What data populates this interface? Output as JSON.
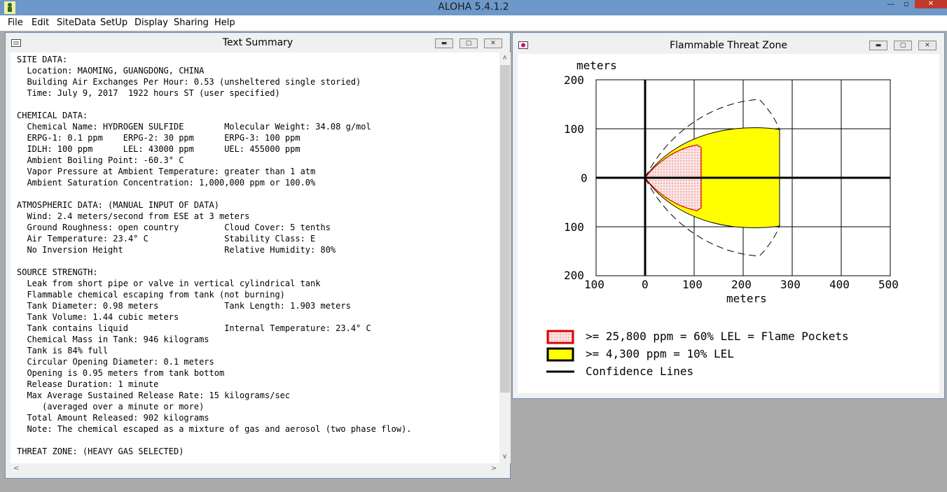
{
  "app": {
    "title": "ALOHA 5.4.1.2"
  },
  "menu": [
    "File",
    "Edit",
    "SiteData",
    "SetUp",
    "Display",
    "Sharing",
    "Help"
  ],
  "text_window": {
    "title": "Text Summary",
    "lines": [
      "SITE DATA:",
      "  Location: MAOMING, GUANGDONG, CHINA",
      "  Building Air Exchanges Per Hour: 0.53 (unsheltered single storied)",
      "  Time: July 9, 2017  1922 hours ST (user specified)",
      "",
      "CHEMICAL DATA:",
      "  Chemical Name: HYDROGEN SULFIDE        Molecular Weight: 34.08 g/mol",
      "  ERPG-1: 0.1 ppm    ERPG-2: 30 ppm      ERPG-3: 100 ppm",
      "  IDLH: 100 ppm      LEL: 43000 ppm      UEL: 455000 ppm",
      "  Ambient Boiling Point: -60.3° C",
      "  Vapor Pressure at Ambient Temperature: greater than 1 atm",
      "  Ambient Saturation Concentration: 1,000,000 ppm or 100.0%",
      "",
      "ATMOSPHERIC DATA: (MANUAL INPUT OF DATA)",
      "  Wind: 2.4 meters/second from ESE at 3 meters",
      "  Ground Roughness: open country         Cloud Cover: 5 tenths",
      "  Air Temperature: 23.4° C               Stability Class: E",
      "  No Inversion Height                    Relative Humidity: 80%",
      "",
      "SOURCE STRENGTH:",
      "  Leak from short pipe or valve in vertical cylindrical tank",
      "  Flammable chemical escaping from tank (not burning)",
      "  Tank Diameter: 0.98 meters             Tank Length: 1.903 meters",
      "  Tank Volume: 1.44 cubic meters",
      "  Tank contains liquid                   Internal Temperature: 23.4° C",
      "  Chemical Mass in Tank: 946 kilograms",
      "  Tank is 84% full",
      "  Circular Opening Diameter: 0.1 meters",
      "  Opening is 0.95 meters from tank bottom",
      "  Release Duration: 1 minute",
      "  Max Average Sustained Release Rate: 15 kilograms/sec",
      "     (averaged over a minute or more)",
      "  Total Amount Released: 902 kilograms",
      "  Note: The chemical escaped as a mixture of gas and aerosol (two phase flow).",
      "",
      "THREAT ZONE: (HEAVY GAS SELECTED)"
    ]
  },
  "plot_window": {
    "title": "Flammable Threat Zone",
    "y_unit_label": "meters",
    "x_unit_label": "meters",
    "y_ticks": [
      "200",
      "100",
      "0",
      "100",
      "200"
    ],
    "x_ticks": [
      "100",
      "0",
      "100",
      "200",
      "300",
      "400",
      "500"
    ],
    "legend": [
      {
        "label": ">= 25,800 ppm = 60% LEL = Flame Pockets",
        "color": "#ff0000"
      },
      {
        "label": ">= 4,300 ppm = 10% LEL",
        "color": "#ffff00"
      },
      {
        "label": "Confidence Lines",
        "color": "#000000"
      }
    ]
  },
  "colors": {
    "yellow_zone": "#ffff00",
    "red_zone": "#ff0000",
    "title_bar": "#6c98ca"
  }
}
